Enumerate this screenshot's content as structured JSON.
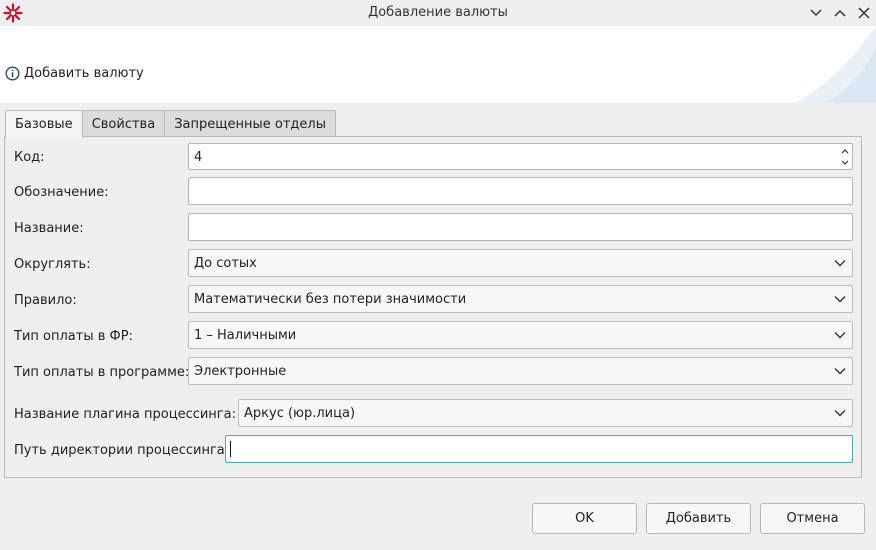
{
  "window": {
    "title": "Добавление  валюты"
  },
  "header": {
    "caption": "Добавить валюту"
  },
  "tabs": [
    {
      "label": "Базовые",
      "active": true
    },
    {
      "label": "Свойства",
      "active": false
    },
    {
      "label": "Запрещенные отделы",
      "active": false
    }
  ],
  "form": {
    "code": {
      "label": "Код:",
      "value": "4"
    },
    "symbol": {
      "label": "Обозначение:",
      "value": ""
    },
    "name": {
      "label": "Название:",
      "value": ""
    },
    "rounding": {
      "label": "Округлять:",
      "value": "До сотых"
    },
    "rule": {
      "label": "Правило:",
      "value": "Математически без потери значимости"
    },
    "fr_payment_type": {
      "label": "Тип оплаты в ФР:",
      "value": "1 – Наличными"
    },
    "program_payment_type": {
      "label": "Тип оплаты в программе:",
      "value": "Электронные"
    },
    "plugin_name": {
      "label": "Название плагина процессинга:",
      "value": "Аркус (юр.лица)"
    },
    "processing_path": {
      "label": "Путь директории процессинга:",
      "value": ""
    }
  },
  "buttons": {
    "ok": "OK",
    "add": "Добавить",
    "cancel": "Отмена"
  },
  "colors": {
    "logo": "#c8102e",
    "focus": "#4fa9b8",
    "panel": "#efefef"
  }
}
